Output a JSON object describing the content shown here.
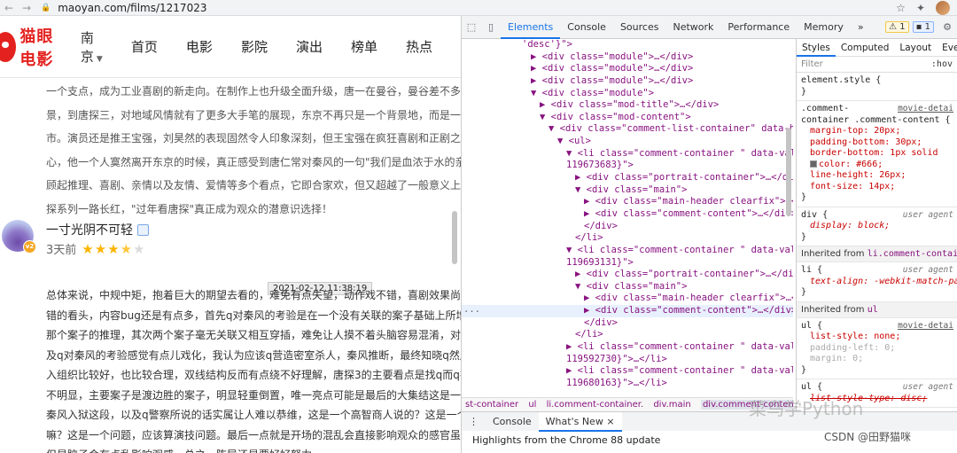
{
  "browser": {
    "url": "maoyan.com/films/1217023"
  },
  "site": {
    "logo_text": "猫眼电影",
    "city": "南京",
    "nav": [
      "首页",
      "电影",
      "影院",
      "演出",
      "榜单",
      "热点"
    ]
  },
  "review1": {
    "lines": [
      "一个支点，成为工业喜剧的新走向。在制作上也升级全面升级，唐一在曼谷，曼谷差不多只关",
      "景，到唐探三，对地域风情就有了更多大手笔的展现，东京不再只是一个背景地，而是一个后",
      "市。演员还是推王宝强，刘昊然的表现固然令人印象深刻，但王宝强在疯狂喜剧和正剧之间的",
      "心，他一个人寞然离开东京的时候，真正感受到唐仁常对秦风的一句\"我们是血浓于水的亲戚",
      "顾起推理、喜剧、亲情以及友情、爱情等多个看点，它即合家欢，但又超越了一般意义上的合",
      "探系列一路长红，\"过年看唐探\"真正成为观众的潜意识选择！"
    ]
  },
  "review2": {
    "username": "一寸光阴不可轻",
    "time": "3天前",
    "avatar_badge": "v2",
    "rating_stars": 3.5,
    "tooltip": "2021-02-12 11:38:19",
    "lines": [
      "总体来说，中规中矩，抱着巨大的期望去看的，难免有点失望，动作戏不错，喜剧效果尚佳，",
      "错的看头，内容bug还是有点多，首先q对秦风的考验是在一个没有关联的案子基础上所增加",
      "那个案子的推理，其次两个案子毫无关联又相互穿插，难免让人摸不着头脑容易混淆，对原有",
      "及q对秦风的考验感觉有点儿戏化，我认为应该q营造密室杀人，秦风推断，最终知晓q然后q",
      "入组织比较好，也比较合理，双线结构反而有点绕不好理解，唐探3的主要看点是找q而q在其",
      "不明显，主要案子是渡边胜的案子，明显轻重倒置，唯一亮点可能是最后的大集结这是一个加",
      "秦风入狱这段，以及q警察所说的话实属让人难以恭维，这是一个高智商人说的？这是一个邪",
      "嘛？这是一个问题，应该算演技问题。最后一点就是开场的混乱会直接影响观众的感官虽然后",
      "但是脑子会有点乱影响观感，总之，陈导还是要好好努力"
    ]
  },
  "devtools": {
    "tabs": [
      "Elements",
      "Console",
      "Sources",
      "Network",
      "Performance",
      "Memory"
    ],
    "active_tab": "Elements",
    "warn_count": "1",
    "info_count": "1",
    "elements_lines": [
      "'desc'}\">",
      "▶ <div class=\"module\">…</div>",
      "▶ <div class=\"module\">…</div>",
      "▶ <div class=\"module\">…</div>",
      "▼ <div class=\"module\">",
      "▶ <div class=\"mod-title\">…</div>",
      "▼ <div class=\"mod-content\">",
      "▼ <div class=\"comment-list-container\" data-hot",
      "▼ <ul>",
      "▼ <li class=\"comment-container \" data-val=\"",
      "119673683}\">",
      "▶ <div class=\"portrait-container\">…</div>",
      "▼ <div class=\"main\">",
      "▶ <div class=\"main-header clearfix\">…</",
      "▶ <div class=\"comment-content\">…</div>",
      "</div>",
      "</li>",
      "▼ <li class=\"comment-container \" data-val=\"",
      "119693131}\">",
      "▶ <div class=\"portrait-container\">…</div>",
      "▼ <div class=\"main\">",
      "▶ <div class=\"main-header clearfix\">…</",
      "▶ <div class=\"comment-content\">…</div>",
      "</div>",
      "</li>",
      "▶ <li class=\"comment-container \" data-val=\"",
      "119592730}\">…</li>",
      "▶ <li class=\"comment-container \" data-val=\"",
      "119680163}\">…</li>"
    ],
    "breadcrumbs": [
      "st-container",
      "ul",
      "li.comment-container.",
      "div.main",
      "div.comment-content"
    ],
    "styles_tabs": [
      "Styles",
      "Computed",
      "Layout",
      "Event"
    ],
    "filter_placeholder": "Filter",
    "hov": ":hov",
    "rules": {
      "element_style": "element.style {",
      "r1_selector_a": ".comment-",
      "r1_selector_b": "container .comment-content {",
      "r1_src": "movie-detai",
      "r1_props": [
        "margin-top: 20px;",
        "padding-bottom: 30px;",
        "border-bottom: 1px solid",
        "color: #666;",
        "line-height: 26px;",
        "font-size: 14px;"
      ],
      "r2_selector": "div {",
      "r2_src": "user agent",
      "r2_props": [
        "display: block;"
      ],
      "inh1_label": "Inherited from",
      "inh1_ref": "li.comment-containe",
      "r3_selector": "li {",
      "r3_src": "user agent",
      "r3_props": [
        "text-align: -webkit-match-pa"
      ],
      "inh2_label": "Inherited from",
      "inh2_ref": "ul",
      "r4_selector": "ul {",
      "r4_src": "movie-detai",
      "r4_props": [
        "list-style: none;",
        "padding-left: 0;",
        "margin: 0;"
      ],
      "r5_selector": "ul {",
      "r5_src": "user agent",
      "r5_props": [
        "list-style-type: disc;"
      ],
      "close": "}"
    },
    "drawer_tabs": [
      "Console",
      "What's New ×"
    ],
    "drawer_text": "Highlights from the Chrome 88 update"
  },
  "watermark": "菜鸟学Python",
  "credit": "CSDN @田野猫咪"
}
